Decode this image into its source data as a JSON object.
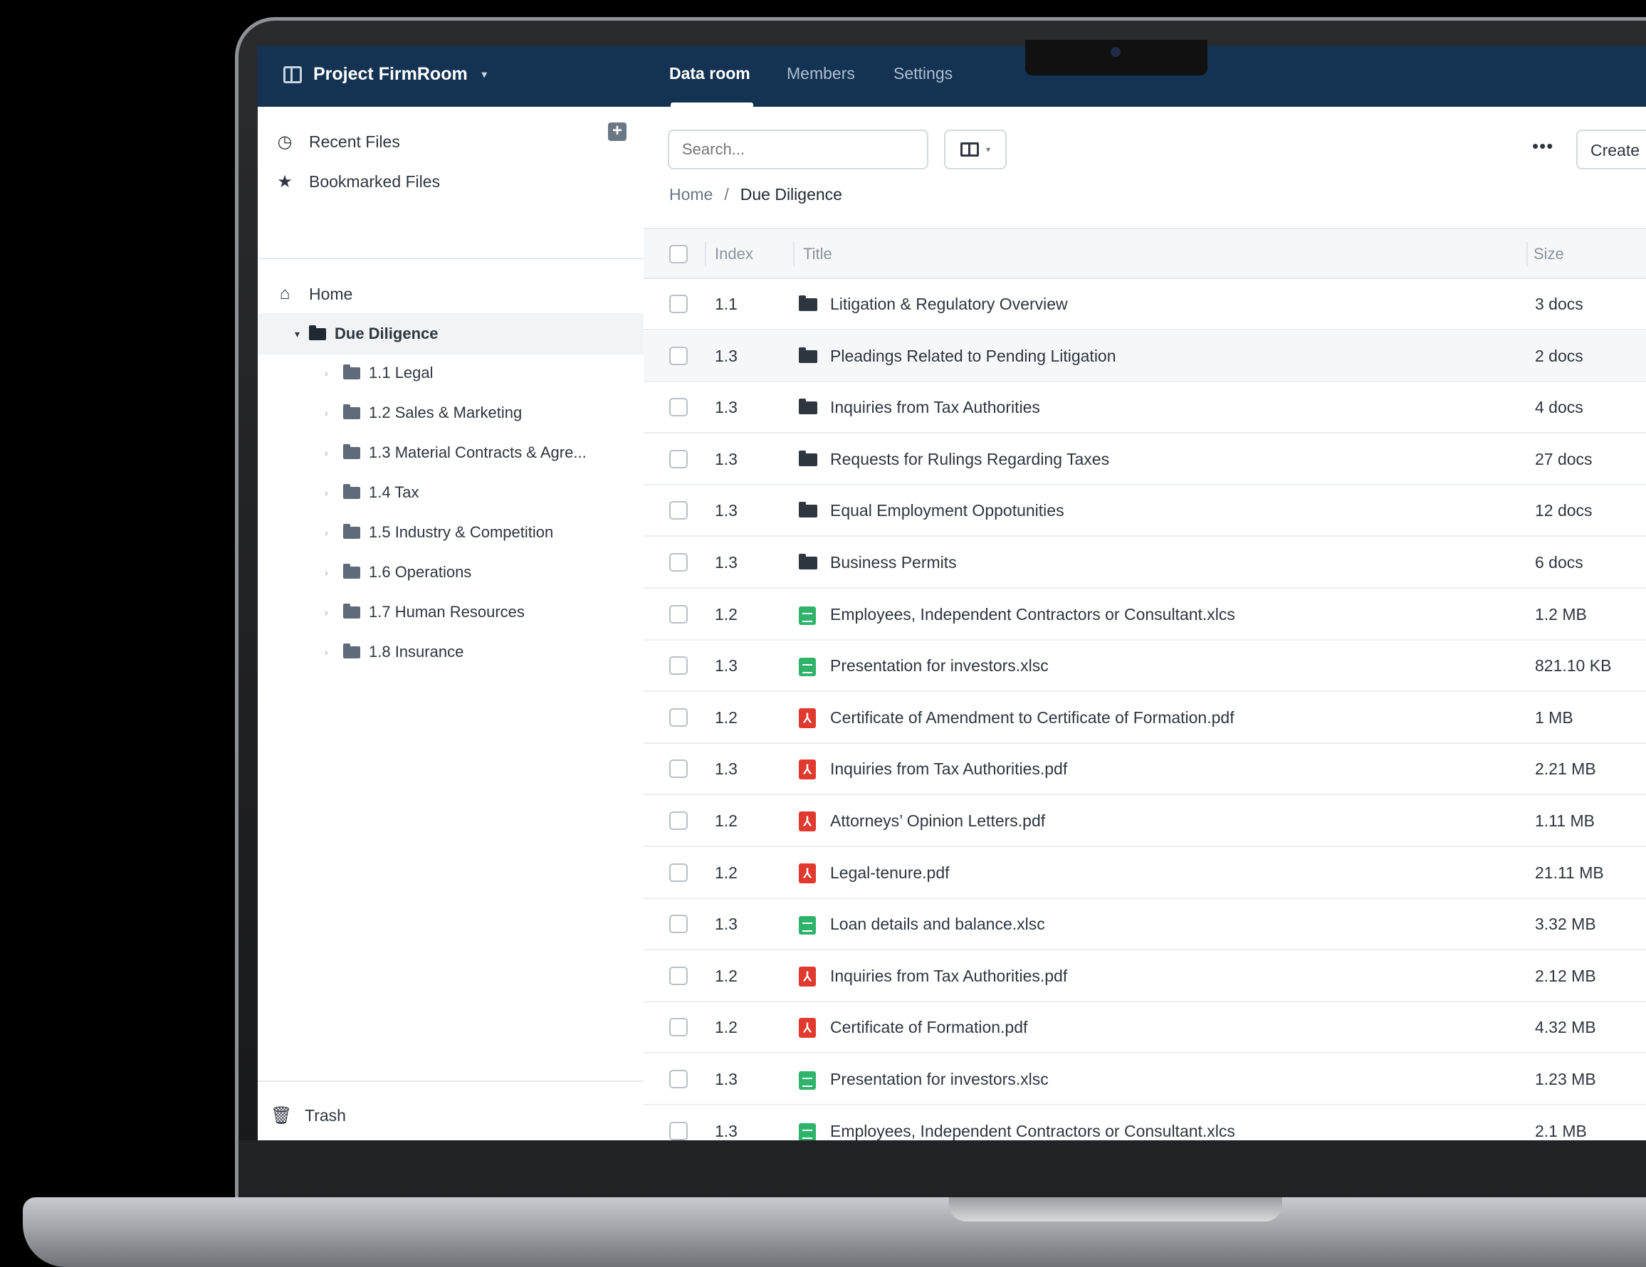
{
  "header": {
    "project_name": "Project FirmRoom",
    "tabs": [
      {
        "label": "Data room",
        "active": true
      },
      {
        "label": "Members",
        "active": false
      },
      {
        "label": "Settings",
        "active": false
      }
    ]
  },
  "sidebar": {
    "quick": [
      {
        "label": "Recent Files",
        "icon": "clock-icon"
      },
      {
        "label": "Bookmarked Files",
        "icon": "star-icon"
      }
    ],
    "home_label": "Home",
    "current_folder": "Due Diligence",
    "tree": [
      {
        "label": "1.1 Legal"
      },
      {
        "label": "1.2 Sales & Marketing"
      },
      {
        "label": "1.3 Material Contracts & Agre..."
      },
      {
        "label": "1.4 Tax"
      },
      {
        "label": "1.5 Industry & Competition"
      },
      {
        "label": "1.6 Operations"
      },
      {
        "label": "1.7 Human Resources"
      },
      {
        "label": "1.8 Insurance"
      }
    ],
    "trash_label": "Trash"
  },
  "toolbar": {
    "search_placeholder": "Search...",
    "more_label": "•••",
    "create_label": "Create"
  },
  "breadcrumb": {
    "home": "Home",
    "separator": "/",
    "current": "Due Diligence"
  },
  "table": {
    "headers": {
      "index": "Index",
      "title": "Title",
      "size": "Size"
    },
    "rows": [
      {
        "index": "1.1",
        "title": "Litigation & Regulatory Overview",
        "size": "3 docs",
        "type": "folder"
      },
      {
        "index": "1.3",
        "title": "Pleadings Related to Pending Litigation",
        "size": "2 docs",
        "type": "folder"
      },
      {
        "index": "1.3",
        "title": "Inquiries from Tax Authorities",
        "size": "4 docs",
        "type": "folder"
      },
      {
        "index": "1.3",
        "title": "Requests for Rulings Regarding Taxes",
        "size": "27 docs",
        "type": "folder"
      },
      {
        "index": "1.3",
        "title": "Equal Employment Oppotunities",
        "size": "12 docs",
        "type": "folder"
      },
      {
        "index": "1.3",
        "title": "Business Permits",
        "size": "6 docs",
        "type": "folder"
      },
      {
        "index": "1.2",
        "title": "Employees, Independent Contractors or Consultant.xlcs",
        "size": "1.2 MB",
        "type": "sheet"
      },
      {
        "index": "1.3",
        "title": "Presentation for investors.xlsc",
        "size": "821.10 KB",
        "type": "sheet"
      },
      {
        "index": "1.2",
        "title": "Certificate of Amendment to Certificate of Formation.pdf",
        "size": "1 MB",
        "type": "pdf"
      },
      {
        "index": "1.3",
        "title": "Inquiries from Tax Authorities.pdf",
        "size": "2.21 MB",
        "type": "pdf"
      },
      {
        "index": "1.2",
        "title": "Attorneys’ Opinion Letters.pdf",
        "size": "1.11 MB",
        "type": "pdf"
      },
      {
        "index": "1.2",
        "title": "Legal-tenure.pdf",
        "size": "21.11 MB",
        "type": "pdf"
      },
      {
        "index": "1.3",
        "title": "Loan details and balance.xlsc",
        "size": "3.32 MB",
        "type": "sheet"
      },
      {
        "index": "1.2",
        "title": "Inquiries from Tax Authorities.pdf",
        "size": "2.12 MB",
        "type": "pdf"
      },
      {
        "index": "1.2",
        "title": "Certificate of Formation.pdf",
        "size": "4.32 MB",
        "type": "pdf"
      },
      {
        "index": "1.3",
        "title": "Presentation for investors.xlsc",
        "size": "1.23 MB",
        "type": "sheet"
      },
      {
        "index": "1.3",
        "title": "Employees, Independent Contractors or Consultant.xlcs",
        "size": "2.1 MB",
        "type": "sheet"
      }
    ]
  },
  "colors": {
    "topbar": "#143352",
    "sheet": "#2fb36b",
    "pdf": "#e03a2f"
  }
}
